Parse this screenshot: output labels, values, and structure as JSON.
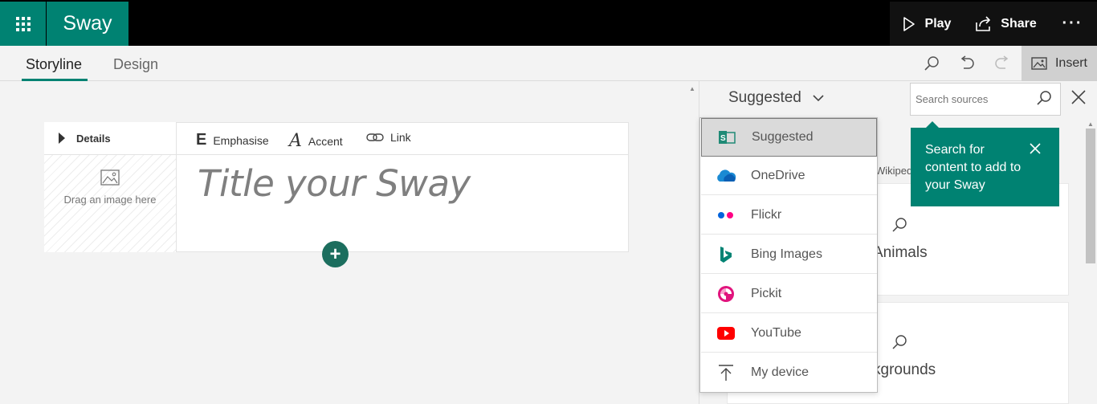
{
  "app": {
    "brand": "Sway"
  },
  "topbar": {
    "play_label": "Play",
    "share_label": "Share",
    "more_label": "···"
  },
  "tabs": [
    {
      "label": "Storyline"
    },
    {
      "label": "Design"
    }
  ],
  "toolbar": {
    "insert_label": "Insert"
  },
  "card": {
    "details_label": "Details",
    "image_hint": "Drag an image here",
    "format": {
      "emphasise": "Emphasise",
      "accent": "Accent",
      "link": "Link"
    },
    "title_placeholder": "Title your Sway"
  },
  "pane": {
    "source_selected": "Suggested",
    "search_placeholder": "Search sources",
    "categories": [
      {
        "label": "Animals"
      },
      {
        "label": "kgrounds"
      }
    ],
    "partial_text": "Wikiped",
    "tooltip": "Search for content to add to your Sway"
  },
  "dropdown": {
    "items": [
      {
        "label": "Suggested",
        "icon": "suggested-icon"
      },
      {
        "label": "OneDrive",
        "icon": "onedrive-icon"
      },
      {
        "label": "Flickr",
        "icon": "flickr-icon"
      },
      {
        "label": "Bing Images",
        "icon": "bing-icon"
      },
      {
        "label": "Pickit",
        "icon": "pickit-icon"
      },
      {
        "label": "YouTube",
        "icon": "youtube-icon"
      },
      {
        "label": "My device",
        "icon": "upload-icon"
      }
    ]
  },
  "colors": {
    "accent": "#008272",
    "topbar": "#000000",
    "button_dark": "#1c6e5e"
  }
}
